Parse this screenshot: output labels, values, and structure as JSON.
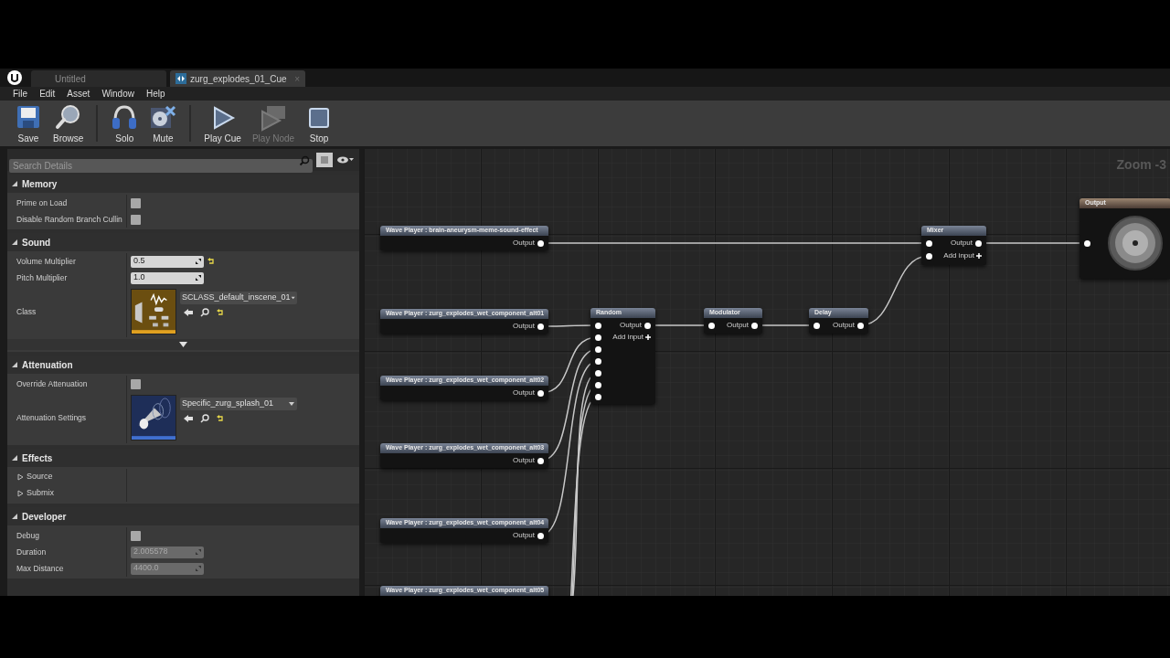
{
  "tabs": [
    {
      "label": "Untitled",
      "selected": false
    },
    {
      "label": "zurg_explodes_01_Cue",
      "selected": true,
      "close": "×"
    }
  ],
  "menu": [
    "File",
    "Edit",
    "Asset",
    "Window",
    "Help"
  ],
  "toolbar": [
    {
      "kind": "save",
      "label": "Save",
      "disabled": false,
      "separator_before": false
    },
    {
      "kind": "browse",
      "label": "Browse",
      "disabled": false,
      "separator_before": false
    },
    {
      "kind": "solo",
      "label": "Solo",
      "disabled": false,
      "separator_before": true
    },
    {
      "kind": "mute",
      "label": "Mute",
      "disabled": false,
      "separator_before": false
    },
    {
      "kind": "play_cue",
      "label": "Play Cue",
      "disabled": false,
      "separator_before": true
    },
    {
      "kind": "play_node",
      "label": "Play Node",
      "disabled": true,
      "separator_before": false
    },
    {
      "kind": "stop",
      "label": "Stop",
      "disabled": false,
      "separator_before": false
    }
  ],
  "details": {
    "search": {
      "placeholder": "Search Details"
    },
    "categories": [
      {
        "title": "Memory",
        "expanded": true,
        "advanced": false,
        "rows": [
          {
            "kind": "checkbox",
            "label": "Prime on Load",
            "checked": false
          },
          {
            "kind": "checkbox",
            "label": "Disable Random Branch Cullin",
            "checked": false
          }
        ]
      },
      {
        "title": "Sound",
        "expanded": true,
        "advanced": true,
        "rows": [
          {
            "kind": "number",
            "label": "Volume Multiplier",
            "value": "0.5",
            "disabled": false,
            "reset": true
          },
          {
            "kind": "number",
            "label": "Pitch Multiplier",
            "value": "1.0",
            "disabled": false,
            "reset": false
          },
          {
            "kind": "sound_class_asset",
            "label": "Class",
            "value": "SCLASS_default_inscene_01",
            "reset": true
          }
        ]
      },
      {
        "title": "Attenuation",
        "expanded": true,
        "advanced": false,
        "rows": [
          {
            "kind": "checkbox",
            "label": "Override Attenuation",
            "checked": false
          },
          {
            "kind": "attenuation_asset",
            "label": "Attenuation Settings",
            "value": "Specific_zurg_splash_01",
            "reset": true
          }
        ]
      },
      {
        "title": "Effects",
        "expanded": true,
        "advanced": false,
        "rows": [
          {
            "kind": "group",
            "label": "Source",
            "expanded": false
          },
          {
            "kind": "group",
            "label": "Submix",
            "expanded": false
          }
        ]
      },
      {
        "title": "Developer",
        "expanded": true,
        "advanced": false,
        "rows": [
          {
            "kind": "checkbox",
            "label": "Debug",
            "checked": false
          },
          {
            "kind": "number",
            "label": "Duration",
            "value": "2.005578",
            "disabled": true,
            "reset": false
          },
          {
            "kind": "number",
            "label": "Max Distance",
            "value": "4400.0",
            "disabled": true,
            "reset": false
          }
        ]
      }
    ]
  },
  "graph": {
    "zoom_label": "Zoom -3",
    "nodes": [
      {
        "kind": "wave_player",
        "title": "Wave Player : brain-aneurysm-meme-sound-effect",
        "output": "Output"
      },
      {
        "kind": "wave_player",
        "title": "Wave Player : zurg_explodes_wet_component_alt01",
        "output": "Output"
      },
      {
        "kind": "wave_player",
        "title": "Wave Player : zurg_explodes_wet_component_alt02",
        "output": "Output"
      },
      {
        "kind": "wave_player",
        "title": "Wave Player : zurg_explodes_wet_component_alt03",
        "output": "Output"
      },
      {
        "kind": "wave_player",
        "title": "Wave Player : zurg_explodes_wet_component_alt04",
        "output": "Output"
      },
      {
        "kind": "wave_player",
        "title": "Wave Player : zurg_explodes_wet_component_alt05"
      },
      {
        "kind": "random",
        "title": "Random",
        "output": "Output",
        "add_input": "Add input"
      },
      {
        "kind": "modulator",
        "title": "Modulator",
        "output": "Output"
      },
      {
        "kind": "delay",
        "title": "Delay",
        "output": "Output"
      },
      {
        "kind": "mixer",
        "title": "Mixer",
        "output": "Output",
        "add_input": "Add input"
      },
      {
        "kind": "output",
        "title": "Output"
      }
    ]
  }
}
